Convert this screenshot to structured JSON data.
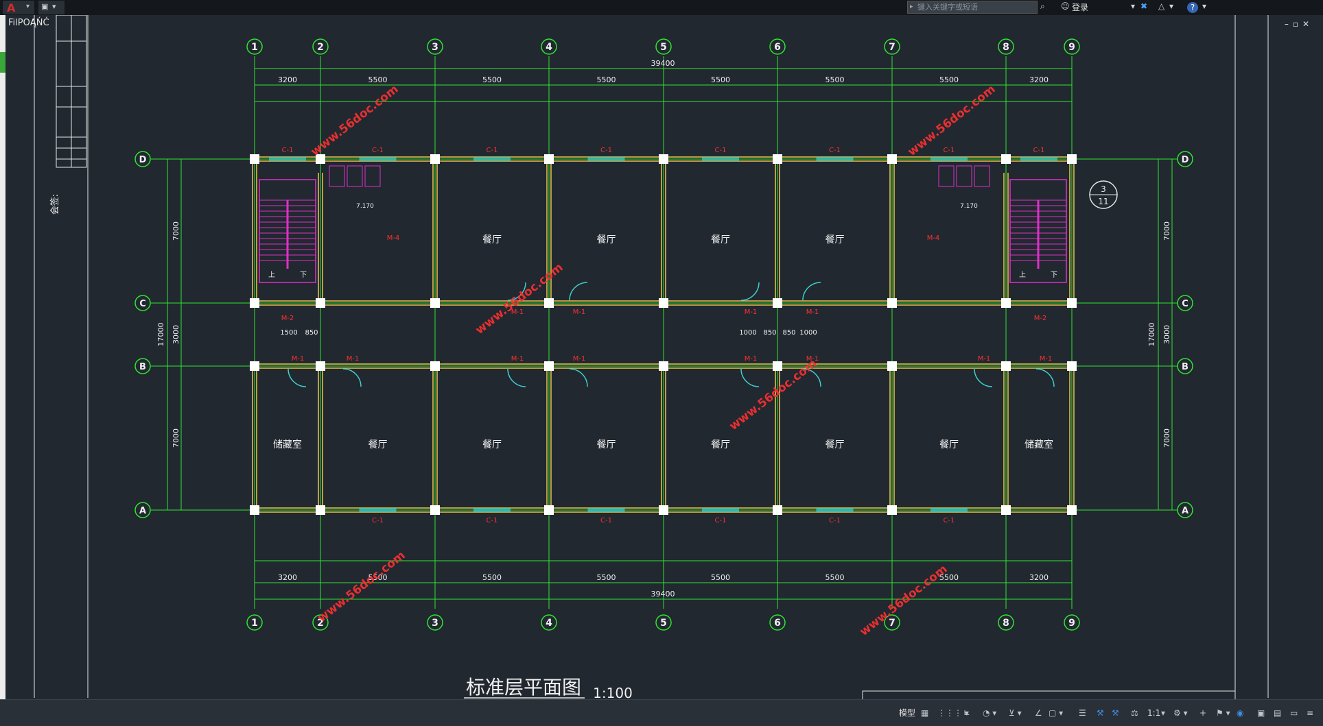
{
  "toolbar": {
    "app_logo": "A",
    "search_placeholder": "键入关键字或短语",
    "login_label": "登录",
    "overlay_text": "FilPOĄŃĆ"
  },
  "drawing": {
    "title": "标准层平面图",
    "scale": "1:100",
    "watermark": "www.56doc.com",
    "axes_vertical": [
      "1",
      "2",
      "3",
      "4",
      "5",
      "6",
      "7",
      "8",
      "9"
    ],
    "axes_horizontal": [
      "D",
      "C",
      "B",
      "A"
    ],
    "dims_top_total": "39400",
    "dims_top_bays": [
      "3200",
      "5500",
      "5500",
      "5500",
      "5500",
      "5500",
      "5500",
      "3200"
    ],
    "dims_bottom_total": "39400",
    "dims_bottom_bays": [
      "3200",
      "5500",
      "5500",
      "5500",
      "5500",
      "5500",
      "5500",
      "3200"
    ],
    "dims_left_total": "17000",
    "dims_left_parts": [
      "7000",
      "3000",
      "7000"
    ],
    "dims_right_total": "17000",
    "dims_right_parts": [
      "7000",
      "3000",
      "7000"
    ],
    "rooms_north": [
      "餐厅",
      "餐厅",
      "餐厅",
      "餐厅"
    ],
    "rooms_south": [
      "储藏室",
      "餐厅",
      "餐厅",
      "餐厅",
      "餐厅",
      "餐厅",
      "餐厅",
      "储藏室"
    ],
    "window_label": "C-1",
    "door_label": "M-1",
    "door2_label": "M-2",
    "door4_label": "M-4",
    "stair_up": "上",
    "stair_down": "下",
    "detail_top": "3",
    "detail_bottom": "11",
    "level_mark": "7.170",
    "corridor_dims": [
      "1000",
      "850",
      "850",
      "1000"
    ],
    "left_corridor_dims": [
      "1500",
      "850"
    ],
    "margin_label": "会签:"
  },
  "statusbar": {
    "model_label": "模型",
    "scale_label": "1:1"
  },
  "colors": {
    "background": "#212830",
    "grid_green": "#2fe62f",
    "wall_yellow": "#e8c84a",
    "text_red": "#ff3030",
    "window_cyan": "#40d0d0",
    "stair_magenta": "#e030c8"
  }
}
